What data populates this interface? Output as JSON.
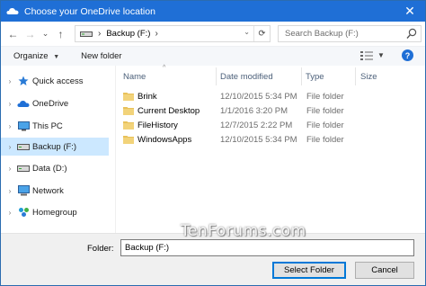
{
  "window": {
    "title": "Choose your OneDrive location",
    "close_glyph": "✕"
  },
  "address": {
    "back_glyph": "←",
    "forward_glyph": "→",
    "recent_glyph": "⌄",
    "up_glyph": "↑",
    "path_label": "Backup (F:)",
    "chevron": "›",
    "dropdown_glyph": "⌄",
    "refresh_glyph": "⟳"
  },
  "search": {
    "placeholder": "Search Backup (F:)"
  },
  "toolbar": {
    "organize_label": "Organize",
    "organize_caret": "▼",
    "new_folder_label": "New folder",
    "view_caret": "▼",
    "help_label": "?"
  },
  "nav": {
    "expand_glyph": "›",
    "items": [
      {
        "label": "Quick access",
        "icon": "star-icon",
        "selected": false
      },
      {
        "label": "OneDrive",
        "icon": "cloud-icon",
        "selected": false
      },
      {
        "label": "This PC",
        "icon": "computer-icon",
        "selected": false
      },
      {
        "label": "Backup (F:)",
        "icon": "drive-icon",
        "selected": true
      },
      {
        "label": "Data (D:)",
        "icon": "drive-icon",
        "selected": false
      },
      {
        "label": "Network",
        "icon": "network-icon",
        "selected": false
      },
      {
        "label": "Homegroup",
        "icon": "homegroup-icon",
        "selected": false
      }
    ]
  },
  "columns": {
    "name": "Name",
    "date": "Date modified",
    "type": "Type",
    "size": "Size",
    "sort_glyph": "^"
  },
  "files": [
    {
      "name": "Brink",
      "date": "12/10/2015 5:34 PM",
      "type": "File folder"
    },
    {
      "name": "Current Desktop",
      "date": "1/1/2016 3:20 PM",
      "type": "File folder"
    },
    {
      "name": "FileHistory",
      "date": "12/7/2015 2:22 PM",
      "type": "File folder"
    },
    {
      "name": "WindowsApps",
      "date": "12/10/2015 5:34 PM",
      "type": "File folder"
    }
  ],
  "footer": {
    "folder_label": "Folder:",
    "folder_value": "Backup (F:)",
    "select_button": "Select Folder",
    "cancel_button": "Cancel"
  },
  "watermark": "TenForums.com",
  "colors": {
    "titlebar": "#1f6fd6",
    "selection": "#cce8ff",
    "folder": "#e8c15a",
    "footer_bg": "#f0f0f0"
  }
}
